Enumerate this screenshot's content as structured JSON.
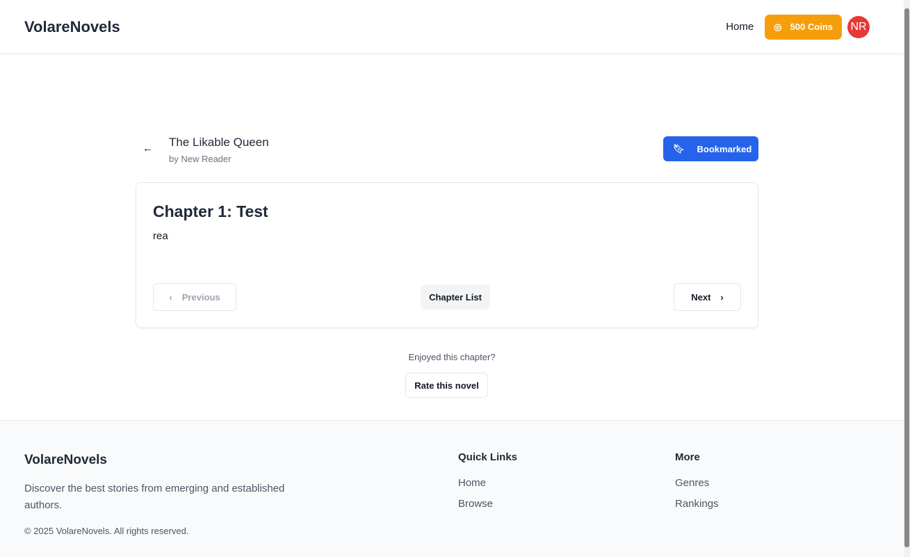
{
  "header": {
    "logo": "VolareNovels",
    "home": "Home",
    "coins": "500 Coins",
    "avatar": "NR"
  },
  "novel": {
    "title": "The Likable Queen",
    "author": "by New Reader",
    "bookmark": "Bookmarked"
  },
  "chapter": {
    "title": "Chapter 1: Test",
    "body": "rea",
    "previous": "Previous",
    "list": "Chapter List",
    "next": "Next"
  },
  "rating": {
    "prompt": "Enjoyed this chapter?",
    "button": "Rate this novel"
  },
  "footer": {
    "logo": "VolareNovels",
    "description": "Discover the best stories from emerging and established authors.",
    "copyright": "© 2025 VolareNovels. All rights reserved.",
    "quick": {
      "heading": "Quick Links",
      "links": [
        "Home",
        "Browse"
      ]
    },
    "more": {
      "heading": "More",
      "links": [
        "Genres",
        "Rankings"
      ]
    }
  }
}
